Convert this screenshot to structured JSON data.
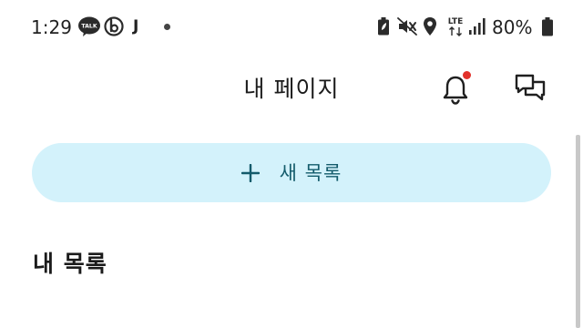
{
  "status_bar": {
    "time": "1:29",
    "notification_icons": [
      "kakaotalk-icon",
      "b-app-icon",
      "j-app-icon",
      "more-dot-icon"
    ],
    "j_app_letter": "J",
    "system_icons": [
      "battery-saver-icon",
      "vibrate-mute-icon",
      "location-icon",
      "lte-icon",
      "signal-icon"
    ],
    "talk_badge": "TALK",
    "lte_label": "LTE",
    "battery_percent": "80%"
  },
  "header": {
    "title": "내 페이지",
    "notification_dot_color": "#e2322b"
  },
  "new_list_button": {
    "label": "새 목록",
    "background_color": "#d3f2fb",
    "text_color": "#135b6b"
  },
  "section": {
    "title": "내 목록"
  }
}
